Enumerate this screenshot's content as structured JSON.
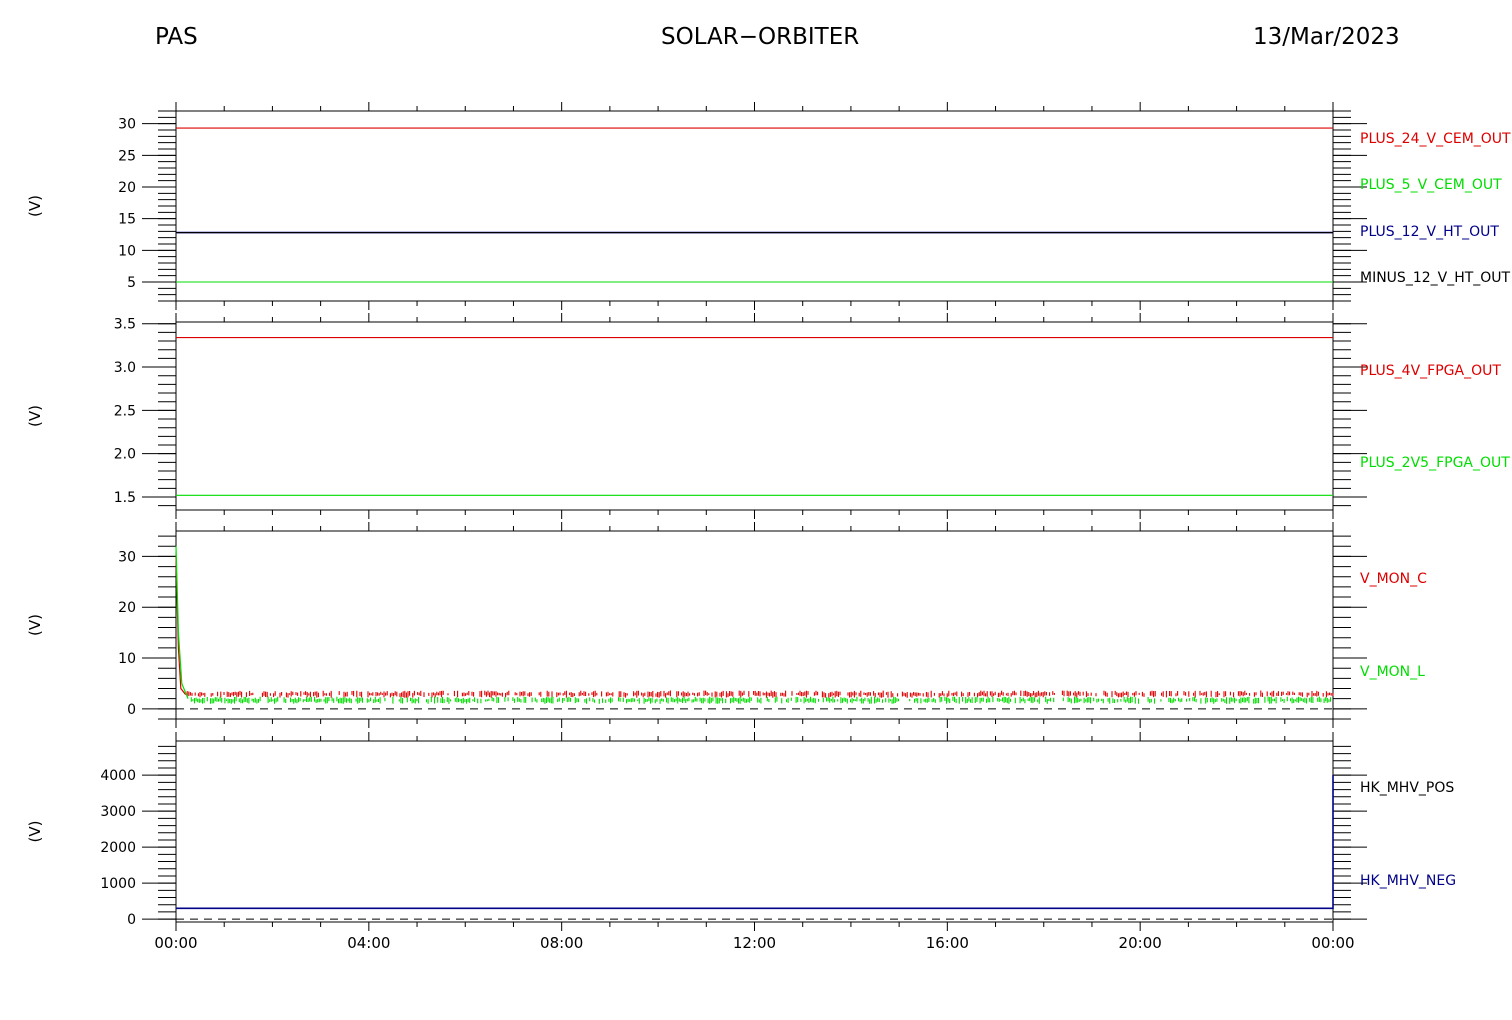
{
  "header": {
    "left": "PAS",
    "center": "SOLAR−ORBITER",
    "right": "13/Mar/2023"
  },
  "colors": {
    "red": "#dd0000",
    "green": "#00dd00",
    "blue": "#000088",
    "black": "#000000"
  },
  "chart_data": [
    {
      "type": "line",
      "ylabel": "(V)",
      "ylim": [
        2,
        32
      ],
      "yticks": [
        5,
        10,
        15,
        20,
        25,
        30
      ],
      "ytick_labels": [
        "5",
        "10",
        "15",
        "20",
        "25",
        "30"
      ],
      "xlim": [
        0,
        24
      ],
      "series": [
        {
          "name": "PLUS_24_V_CEM_OUT",
          "color": "red",
          "x": [
            0,
            24
          ],
          "y": [
            29.3,
            29.3
          ]
        },
        {
          "name": "PLUS_5_V_CEM_OUT",
          "color": "green",
          "x": [
            0,
            24
          ],
          "y": [
            5.0,
            5.0
          ]
        },
        {
          "name": "PLUS_12_V_HT_OUT",
          "color": "blue",
          "x": [
            0,
            24
          ],
          "y": [
            12.8,
            12.8
          ]
        },
        {
          "name": "MINUS_12_V_HT_OUT",
          "color": "black",
          "x": [
            0,
            24
          ],
          "y": [
            12.8,
            12.8
          ]
        }
      ]
    },
    {
      "type": "line",
      "ylabel": "(V)",
      "ylim": [
        1.35,
        3.52
      ],
      "yticks": [
        1.5,
        2.0,
        2.5,
        3.0,
        3.5
      ],
      "ytick_labels": [
        "1.5",
        "2.0",
        "2.5",
        "3.0",
        "3.5"
      ],
      "xlim": [
        0,
        24
      ],
      "series": [
        {
          "name": "PLUS_4V_FPGA_OUT",
          "color": "red",
          "x": [
            0,
            24
          ],
          "y": [
            3.34,
            3.34
          ]
        },
        {
          "name": "PLUS_2V5_FPGA_OUT",
          "color": "green",
          "x": [
            0,
            24
          ],
          "y": [
            1.52,
            1.52
          ]
        }
      ]
    },
    {
      "type": "line",
      "ylabel": "(V)",
      "ylim": [
        -2,
        35
      ],
      "yticks": [
        0,
        10,
        20,
        30
      ],
      "ytick_labels": [
        "0",
        "10",
        "20",
        "30"
      ],
      "xlim": [
        0,
        24
      ],
      "zero_line": true,
      "series": [
        {
          "name": "V_MON_C",
          "color": "red",
          "x": [
            0,
            0.05,
            0.1,
            0.2,
            24
          ],
          "y": [
            30,
            12,
            4,
            2.8,
            2.8
          ],
          "noise": [
            2.2,
            3.6
          ]
        },
        {
          "name": "V_MON_L",
          "color": "green",
          "x": [
            0,
            0.05,
            0.12,
            0.25,
            24
          ],
          "y": [
            32,
            15,
            5,
            2.0,
            2.0
          ],
          "noise": [
            1.0,
            2.4
          ]
        }
      ]
    },
    {
      "type": "line",
      "ylabel": "(V)",
      "ylim": [
        -80,
        4950
      ],
      "yticks": [
        0,
        1000,
        2000,
        3000,
        4000
      ],
      "ytick_labels": [
        "0",
        "1000",
        "2000",
        "3000",
        "4000"
      ],
      "xlim": [
        0,
        24
      ],
      "zero_line": true,
      "series": [
        {
          "name": "HK_MHV_POS",
          "color": "black",
          "x": [
            0,
            24
          ],
          "y": [
            300,
            300
          ]
        },
        {
          "name": "HK_MHV_NEG",
          "color": "blue",
          "x": [
            0,
            23.98,
            24,
            24
          ],
          "y": [
            300,
            300,
            300,
            4000
          ]
        }
      ]
    }
  ],
  "xaxis": {
    "ticks": [
      0,
      4,
      8,
      12,
      16,
      20,
      24
    ],
    "tick_labels": [
      "00:00",
      "04:00",
      "08:00",
      "12:00",
      "16:00",
      "20:00",
      "00:00"
    ]
  }
}
